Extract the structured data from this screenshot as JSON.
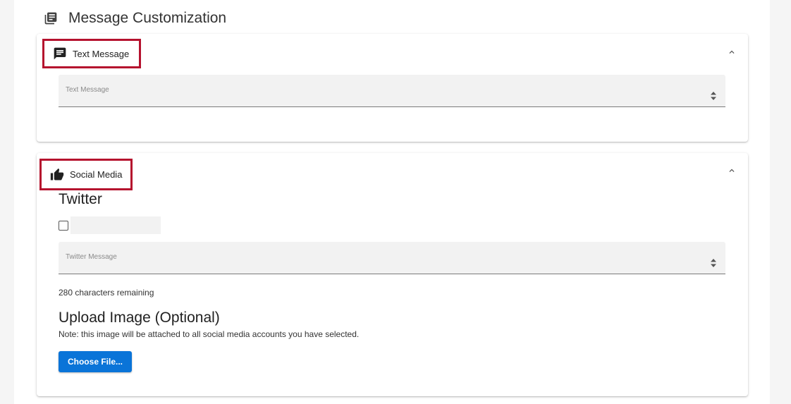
{
  "header": {
    "title": "Message Customization",
    "icon": "library-books-icon"
  },
  "text_section": {
    "title": "Text Message",
    "icon": "chat-message-icon",
    "field_label": "Text Message",
    "field_value": ""
  },
  "social_section": {
    "title": "Social Media",
    "icon": "thumb-up-icon",
    "twitter_heading": "Twitter",
    "twitter_account_checked": false,
    "twitter_field_label": "Twitter Message",
    "twitter_field_value": "",
    "chars_remaining": "280 characters remaining",
    "upload_heading": "Upload Image (Optional)",
    "upload_note": "Note: this image will be attached to all social media accounts you have selected.",
    "choose_file_label": "Choose File..."
  },
  "colors": {
    "highlight_border": "#b5122e",
    "primary_button": "#0a74d8"
  }
}
